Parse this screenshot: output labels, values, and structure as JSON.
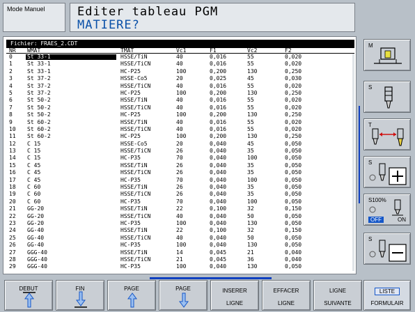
{
  "header": {
    "mode": "Mode Manuel",
    "title": "Editer tableau PGM",
    "subtitle": "MATIERE?"
  },
  "table": {
    "file_label": "Fichier: FRAES_2.CDT",
    "columns": [
      "NR",
      "WMAT",
      "TMAT",
      "Vc1",
      "F1",
      "Vc2",
      "F2"
    ],
    "rows": [
      [
        "0",
        "St 33-1",
        "HSSE/TiN",
        "40",
        "0,016",
        "55",
        "0,020"
      ],
      [
        "1",
        "St 33-1",
        "HSSE/TiCN",
        "40",
        "0,016",
        "55",
        "0,020"
      ],
      [
        "2",
        "St 33-1",
        "HC-P25",
        "100",
        "0,200",
        "130",
        "0,250"
      ],
      [
        "3",
        "St 37-2",
        "HSSE-Co5",
        "20",
        "0,025",
        "45",
        "0,030"
      ],
      [
        "4",
        "St 37-2",
        "HSSE/TiCN",
        "40",
        "0,016",
        "55",
        "0,020"
      ],
      [
        "5",
        "St 37-2",
        "HC-P25",
        "100",
        "0,200",
        "130",
        "0,250"
      ],
      [
        "6",
        "St 50-2",
        "HSSE/TiN",
        "40",
        "0,016",
        "55",
        "0,020"
      ],
      [
        "7",
        "St 50-2",
        "HSSE/TiCN",
        "40",
        "0,016",
        "55",
        "0,020"
      ],
      [
        "8",
        "St 50-2",
        "HC-P25",
        "100",
        "0,200",
        "130",
        "0,250"
      ],
      [
        "9",
        "St 60-2",
        "HSSE/TiN",
        "40",
        "0,016",
        "55",
        "0,020"
      ],
      [
        "10",
        "St 60-2",
        "HSSE/TiCN",
        "40",
        "0,016",
        "55",
        "0,020"
      ],
      [
        "11",
        "St 60-2",
        "HC-P25",
        "100",
        "0,200",
        "130",
        "0,250"
      ],
      [
        "12",
        "C 15",
        "HSSE-Co5",
        "20",
        "0,040",
        "45",
        "0,050"
      ],
      [
        "13",
        "C 15",
        "HSSE/TiCN",
        "26",
        "0,040",
        "35",
        "0,050"
      ],
      [
        "14",
        "C 15",
        "HC-P35",
        "70",
        "0,040",
        "100",
        "0,050"
      ],
      [
        "15",
        "C 45",
        "HSSE/TiN",
        "26",
        "0,040",
        "35",
        "0,050"
      ],
      [
        "16",
        "C 45",
        "HSSE/TiCN",
        "26",
        "0,040",
        "35",
        "0,050"
      ],
      [
        "17",
        "C 45",
        "HC-P35",
        "70",
        "0,040",
        "100",
        "0,050"
      ],
      [
        "18",
        "C 60",
        "HSSE/TiN",
        "26",
        "0,040",
        "35",
        "0,050"
      ],
      [
        "19",
        "C 60",
        "HSSE/TiCN",
        "26",
        "0,040",
        "35",
        "0,050"
      ],
      [
        "20",
        "C 60",
        "HC-P35",
        "70",
        "0,040",
        "100",
        "0,050"
      ],
      [
        "21",
        "GG-20",
        "HSSE/TiN",
        "22",
        "0,100",
        "32",
        "0,150"
      ],
      [
        "22",
        "GG-20",
        "HSSE/TiCN",
        "40",
        "0,040",
        "50",
        "0,050"
      ],
      [
        "23",
        "GG-20",
        "HC-P35",
        "100",
        "0,040",
        "130",
        "0,050"
      ],
      [
        "24",
        "GG-40",
        "HSSE/TiN",
        "22",
        "0,100",
        "32",
        "0,150"
      ],
      [
        "25",
        "GG-40",
        "HSSE/TiCN",
        "40",
        "0,040",
        "50",
        "0,050"
      ],
      [
        "26",
        "GG-40",
        "HC-P35",
        "100",
        "0,040",
        "130",
        "0,050"
      ],
      [
        "27",
        "GGG-40",
        "HSSE/TiN",
        "14",
        "0,045",
        "21",
        "0,040"
      ],
      [
        "28",
        "GGG-40",
        "HSSE/TiCN",
        "21",
        "0,045",
        "36",
        "0,040"
      ],
      [
        "29",
        "GGG-40",
        "HC-P35",
        "100",
        "0,040",
        "130",
        "0,050"
      ]
    ],
    "selected_row": 0
  },
  "side_keys": {
    "m_label": "M",
    "s_label": "S",
    "t_label": "T",
    "s_plus_label": "S",
    "s100_label": "S100%",
    "off_label": "OFF",
    "on_label": "ON",
    "s_minus_label": "S"
  },
  "bottom_keys": {
    "debut": "DEBUT",
    "fin": "FIN",
    "page_up": "PAGE",
    "page_down": "PAGE",
    "inserer_1": "INSERER",
    "inserer_2": "LIGNE",
    "effacer_1": "EFFACER",
    "effacer_2": "LIGNE",
    "ligne_1": "LIGNE",
    "ligne_2": "SUIVANTE",
    "liste": "LISTE",
    "formulair": "FORMULAIR"
  },
  "colors": {
    "accent_blue": "#1456c8",
    "subtitle_blue": "#0a50a8",
    "panel_bg": "#b8c0c8"
  },
  "icons": [
    "spindle-m-icon",
    "spindle-s-icon",
    "tool-change-icon",
    "spindle-plus-icon",
    "spindle-override-icon",
    "spindle-minus-icon",
    "arrow-up-icon",
    "arrow-down-icon"
  ]
}
